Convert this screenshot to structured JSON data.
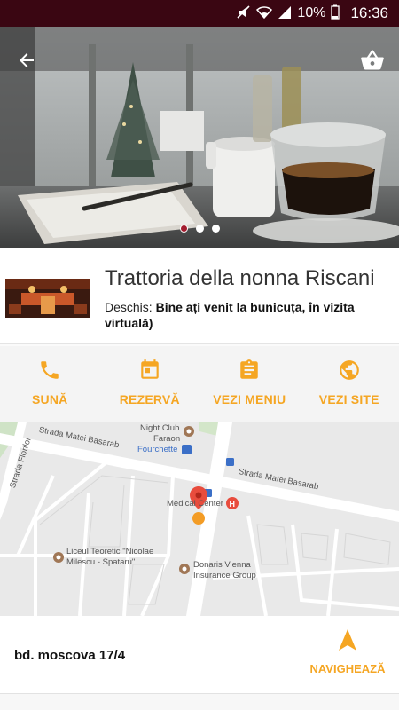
{
  "status_bar": {
    "battery": "10%",
    "time": "16:36"
  },
  "hero": {
    "slides": 3,
    "active_slide": 1
  },
  "restaurant": {
    "name": "Trattoria della nonna Riscani",
    "open_label": "Deschis:",
    "open_message": "Bine ați venit la bunicuța, în vizita virtuală)"
  },
  "actions": [
    {
      "label": "SUNĂ",
      "icon": "phone-icon"
    },
    {
      "label": "REZERVĂ",
      "icon": "calendar-icon"
    },
    {
      "label": "VEZI MENIU",
      "icon": "clipboard-icon"
    },
    {
      "label": "VEZI SITE",
      "icon": "globe-icon"
    }
  ],
  "map": {
    "streets": [
      "Strada Matei Basarab",
      "Strada Matei Basarab",
      "Strada Florilor"
    ],
    "places": [
      "Night Club",
      "Faraon",
      "Fourchette",
      "Medical Center",
      "Liceul Teoretic \"Nicolae",
      "Milescu - Spataru\"",
      "Donaris Vienna",
      "Insurance Group"
    ]
  },
  "address": {
    "text": "bd. moscova 17/4",
    "navigate_label": "NAVIGHEAZĂ"
  },
  "colors": {
    "accent": "#f5a623",
    "status_bar": "#3a0612",
    "pin": "#e84c3d"
  }
}
